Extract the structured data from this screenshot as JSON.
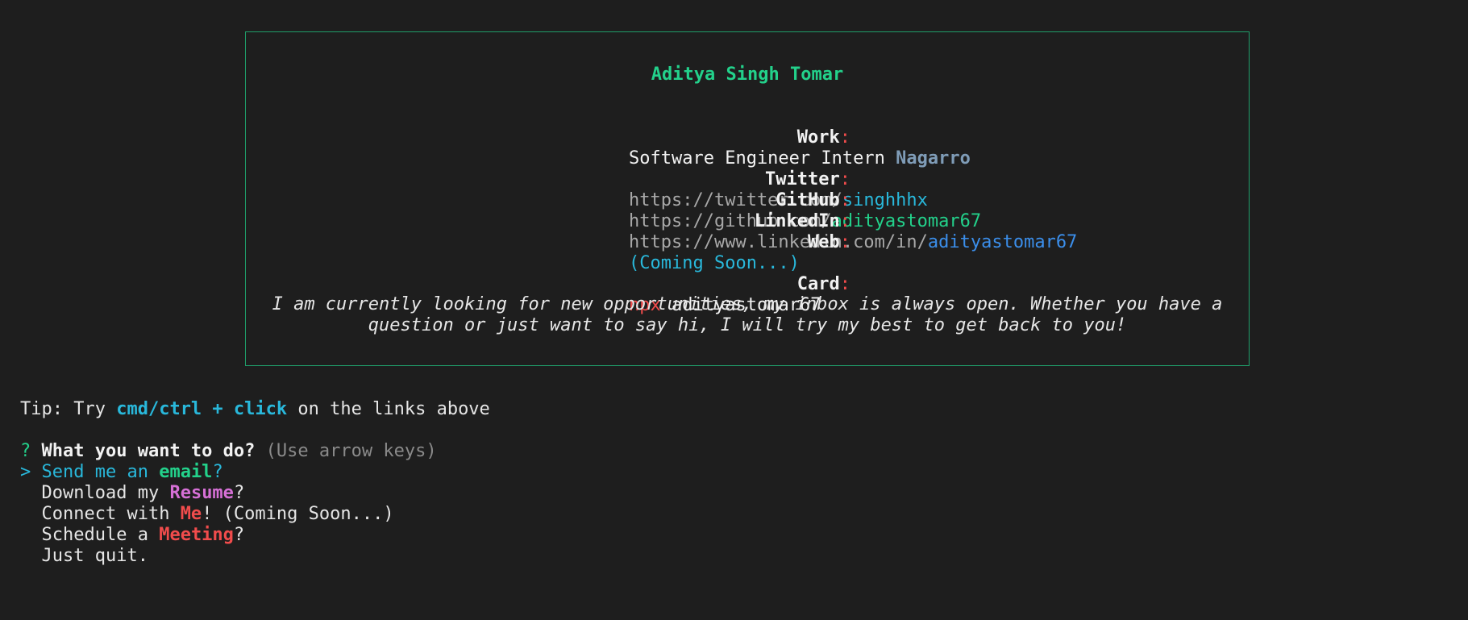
{
  "card": {
    "name": "Aditya Singh Tomar",
    "work": {
      "label": "Work",
      "role": "Software Engineer Intern",
      "company": "Nagarro"
    },
    "twitter": {
      "label": "Twitter",
      "prefix": "https://twitter.com/",
      "handle": "singhhhx"
    },
    "github": {
      "label": "GitHub",
      "prefix": "https://github.com/",
      "handle": "adityastomar67"
    },
    "linkedin": {
      "label": "LinkedIn",
      "prefix": "https://www.linkedin.com/in/",
      "handle": "adityastomar67"
    },
    "web": {
      "label": "Web",
      "value": "(Coming Soon...)"
    },
    "card": {
      "label": "Card",
      "npx": "npx",
      "package": "adityastomar67"
    },
    "colon": ":",
    "quote_line1": "I am currently looking for new opportunities, my inbox is always open. Whether you have a",
    "quote_line2": "question or just want to say hi, I will try my best to get back to you!"
  },
  "tip": {
    "prefix": "Tip: Try ",
    "keys": "cmd/ctrl + click",
    "suffix": " on the links above"
  },
  "prompt": {
    "marker": "?",
    "question": "What you want to do?",
    "hint": "(Use arrow keys)",
    "pointer": ">",
    "options": [
      {
        "pre": "Send me an ",
        "hl": "email",
        "post": "?"
      },
      {
        "pre": "Download my ",
        "hl": "Resume",
        "post": "?"
      },
      {
        "pre": "Connect with ",
        "hl": "Me",
        "post": "! (Coming Soon...)"
      },
      {
        "pre": "Schedule a ",
        "hl": "Meeting",
        "post": "?"
      },
      {
        "pre": "Just quit.",
        "hl": "",
        "post": ""
      }
    ]
  },
  "colors": {
    "background": "#1e1e1e",
    "border": "#1f9e6a",
    "accent_green": "#23d18b",
    "accent_cyan": "#29b8db",
    "accent_red": "#f14c4c",
    "accent_magenta": "#d670d6",
    "accent_blue": "#3b8eea"
  }
}
